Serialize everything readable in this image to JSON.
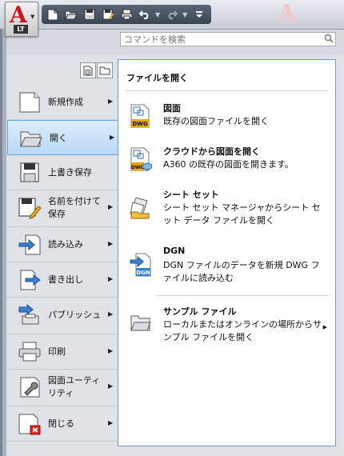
{
  "app": {
    "logo_letter": "A",
    "edition": "LT"
  },
  "quick_access": {
    "icons": [
      "new-icon",
      "open-icon",
      "save-icon",
      "save-as-icon",
      "print-icon",
      "undo-icon",
      "redo-icon",
      "customize-icon"
    ]
  },
  "search": {
    "placeholder": "コマンドを検索",
    "value": ""
  },
  "left_menu": {
    "items": [
      {
        "label": "新規作成",
        "icon": "new-document-icon",
        "has_submenu": true
      },
      {
        "label": "開く",
        "icon": "open-folder-icon",
        "has_submenu": true,
        "selected": true
      },
      {
        "label": "上書き保存",
        "icon": "save-icon",
        "has_submenu": false
      },
      {
        "label": "名前を付けて保存",
        "icon": "save-as-icon",
        "has_submenu": true
      },
      {
        "label": "読み込み",
        "icon": "import-icon",
        "has_submenu": true
      },
      {
        "label": "書き出し",
        "icon": "export-icon",
        "has_submenu": true
      },
      {
        "label": "パブリッシュ",
        "icon": "publish-icon",
        "has_submenu": true
      },
      {
        "label": "印刷",
        "icon": "printer-icon",
        "has_submenu": true
      },
      {
        "label": "図面ユーティリティ",
        "icon": "wrench-icon",
        "has_submenu": true
      },
      {
        "label": "閉じる",
        "icon": "close-document-icon",
        "has_submenu": true
      }
    ]
  },
  "submenu": {
    "title": "ファイルを開く",
    "items": [
      {
        "title": "図面",
        "description": "既存の図面ファイルを開く",
        "icon": "dwg-file-icon",
        "badge": "DWG"
      },
      {
        "title": "クラウドから図面を開く",
        "description": "A360 の既存の図面を開きます。",
        "icon": "cloud-dwg-icon",
        "badge": "DWG"
      },
      {
        "title": "シート セット",
        "description": "シート セット マネージャからシート セット データ ファイルを開く",
        "icon": "sheet-set-icon"
      },
      {
        "title": "DGN",
        "description": "DGN ファイルのデータを新規 DWG ファイルに読み込む",
        "icon": "dgn-file-icon",
        "badge": "DGN"
      },
      {
        "title": "サンプル ファイル",
        "description": "ローカルまたはオンラインの場所からサンプル ファイルを開く",
        "icon": "sample-folder-icon",
        "has_submenu": true
      }
    ]
  },
  "colors": {
    "accent": "#c8161d",
    "selection": "#b9d9f6",
    "selection_border": "#6ea5d8",
    "submenu_border": "#6f9ccf"
  }
}
